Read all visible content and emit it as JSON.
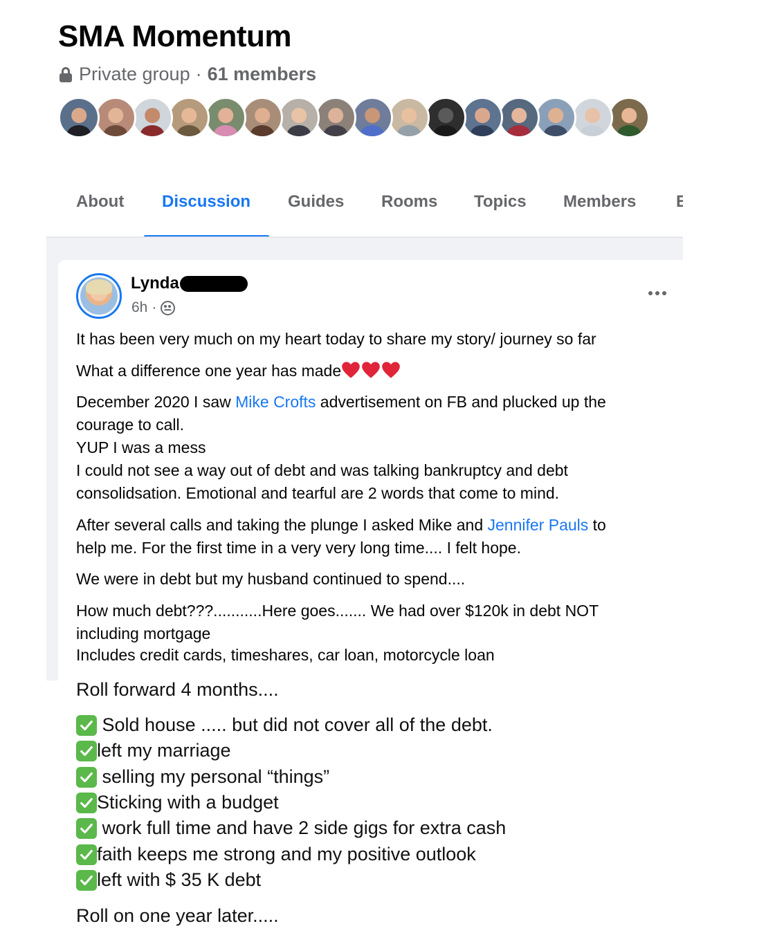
{
  "group": {
    "name": "SMA Momentum",
    "privacy": "Private group",
    "separator": "·",
    "members": "61 members",
    "avatar_colors": [
      {
        "bg": "#5a6f8a",
        "face": "#d9a98a",
        "shoulders": "#1f1f25"
      },
      {
        "bg": "#b88a78",
        "face": "#e2b596",
        "shoulders": "#6e4a3b"
      },
      {
        "bg": "#cfd6dc",
        "face": "#c48a6c",
        "shoulders": "#8a2b2b"
      },
      {
        "bg": "#b59b7b",
        "face": "#e6b898",
        "shoulders": "#6b5a40"
      },
      {
        "bg": "#7a8c6e",
        "face": "#e3b197",
        "shoulders": "#d88cb1"
      },
      {
        "bg": "#a88e79",
        "face": "#e0ae90",
        "shoulders": "#5b3b2c"
      },
      {
        "bg": "#b7b0a8",
        "face": "#e9c3a6",
        "shoulders": "#3d3d48"
      },
      {
        "bg": "#8c8178",
        "face": "#dcb29a",
        "shoulders": "#444049"
      },
      {
        "bg": "#6f7d9b",
        "face": "#c99678",
        "shoulders": "#4f6fc9"
      },
      {
        "bg": "#c9b8a2",
        "face": "#e7c0a0",
        "shoulders": "#96a0a8"
      },
      {
        "bg": "#2e2e2e",
        "face": "#5a5a5a",
        "shoulders": "#1a1a1a"
      },
      {
        "bg": "#5d7390",
        "face": "#d9a88c",
        "shoulders": "#2f3f5a"
      },
      {
        "bg": "#56697e",
        "face": "#e4b69b",
        "shoulders": "#a62d3c"
      },
      {
        "bg": "#8aa0b8",
        "face": "#dfb193",
        "shoulders": "#3e4e68"
      },
      {
        "bg": "#d0d6dc",
        "face": "#e8c2a8",
        "shoulders": "#c9cfd6"
      },
      {
        "bg": "#7b6a4c",
        "face": "#e7b796",
        "shoulders": "#2f5a2e"
      }
    ]
  },
  "tabs": [
    {
      "label": "About",
      "active": false
    },
    {
      "label": "Discussion",
      "active": true
    },
    {
      "label": "Guides",
      "active": false
    },
    {
      "label": "Rooms",
      "active": false
    },
    {
      "label": "Topics",
      "active": false
    },
    {
      "label": "Members",
      "active": false
    },
    {
      "label": "E",
      "active": false
    }
  ],
  "post": {
    "author": "Lynda",
    "time": "6h",
    "dot": "·",
    "lines": {
      "l1": "It has been very much on my heart today to share my story/ journey so far",
      "l2": "What a difference one year has made",
      "l3a": "December 2020  I saw ",
      "l3link": "Mike Crofts",
      "l3b": " advertisement on FB and plucked up the",
      "l4": "courage to call.",
      "l5": "YUP I was a mess",
      "l6": "I could not see a way out of debt and was talking bankruptcy and debt",
      "l7": "consolidsation.  Emotional and tearful are 2 words that come to mind.",
      "l8a": "After several calls and taking the plunge I asked Mike  and ",
      "l8link": "Jennifer Pauls",
      "l8b": " to",
      "l9": "help me. For the first time in a very very long time.... I felt hope.",
      "l10": "We were in debt but my husband continued to spend....",
      "l11": "How much debt???...........Here goes....... We had over $120k in debt NOT",
      "l12": "including mortgage",
      "l13": "Includes credit cards, timeshares, car loan, motorcycle loan"
    },
    "continued": {
      "roll_forward": "Roll forward 4 months....",
      "checklist": [
        " Sold house ..... but did not cover all of the debt.",
        "left my marriage",
        " selling my personal “things”",
        "Sticking with a budget",
        " work full time and have 2 side gigs for extra cash",
        "faith keeps me strong and my positive outlook",
        "left with $ 35 K debt"
      ],
      "roll_on": "Roll on one year later....."
    }
  },
  "colors": {
    "link": "#1877f2",
    "check": "#5bb84a",
    "heart": "#e0243a"
  }
}
